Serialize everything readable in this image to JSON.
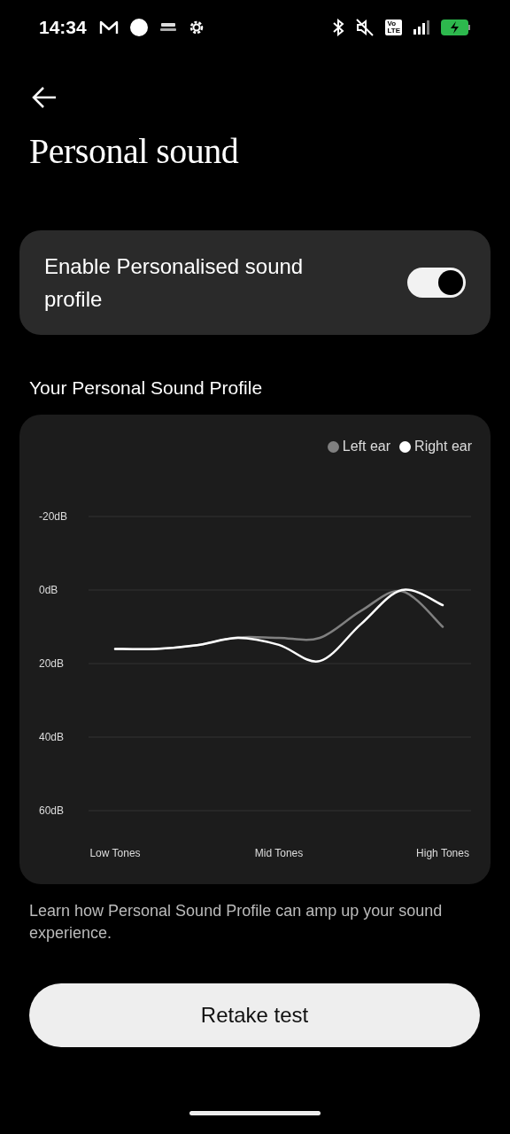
{
  "status_bar": {
    "time": "14:34",
    "volte": [
      "Vo",
      "LTE"
    ],
    "charging": true
  },
  "title": "Personal sound",
  "toggle_card": {
    "label": "Enable Personalised sound profile",
    "on": true
  },
  "section_title": "Your Personal Sound Profile",
  "chart_data": {
    "type": "line",
    "categories": [
      "Low Tones",
      null,
      null,
      null,
      "Mid Tones",
      null,
      null,
      null,
      "High Tones"
    ],
    "series": [
      {
        "name": "Left ear",
        "color": "#808080",
        "values": [
          16,
          16,
          15,
          12.9,
          13,
          13,
          5.7,
          0.3,
          10
        ]
      },
      {
        "name": "Right ear",
        "color": "#ffffff",
        "values": [
          16,
          16,
          15,
          13,
          14.9,
          19.3,
          9.3,
          0,
          4.1
        ]
      }
    ],
    "ylim": [
      60,
      -20
    ],
    "grid": true,
    "yticks": [
      {
        "value": -20,
        "label": "-20dB"
      },
      {
        "value": 0,
        "label": "0dB"
      },
      {
        "value": 20,
        "label": "20dB"
      },
      {
        "value": 40,
        "label": "40dB"
      },
      {
        "value": 60,
        "label": "60dB"
      }
    ]
  },
  "info_text": "Learn how Personal Sound Profile can amp up your sound experience.",
  "button": "Retake test"
}
